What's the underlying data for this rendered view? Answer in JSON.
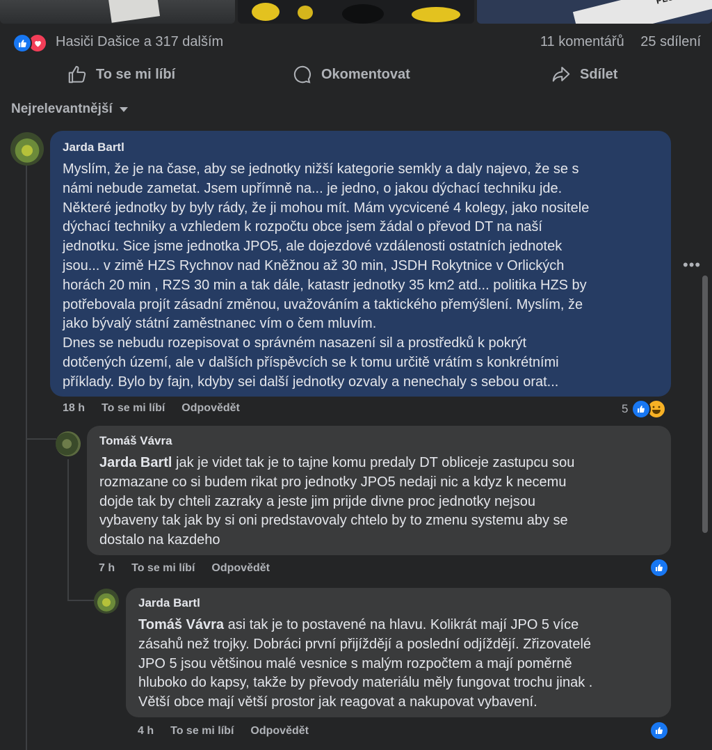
{
  "post": {
    "reactions": {
      "reactors_text": "Hasiči Dašice a 317 dalším",
      "comments_count": "11 komentářů",
      "shares_count": "25 sdílení"
    },
    "actions": {
      "like_label": "To se mi líbí",
      "comment_label": "Okomentovat",
      "share_label": "Sdílet"
    },
    "sort_label": "Nejrelevantnější"
  },
  "comments": [
    {
      "author": "Jarda Bartl",
      "text": "Myslím, že je na čase, aby se jednotky nižší kategorie semkly a daly najevo, že se s\nnámi nebude zametat. Jsem upřímně na... je jedno, o jakou dýchací techniku jde.\nNěkteré jednotky by byly rády, že ji mohou mít. Mám vycvicené 4 kolegy, jako nositele\ndýchací techniky a vzhledem k rozpočtu obce jsem žádal o převod DT na naší\njednotku. Sice jsme jednotka JPO5, ale dojezdové vzdálenosti ostatních jednotek\njsou... v zimě HZS Rychnov nad Kněžnou až 30 min, JSDH Rokytnice v Orlických\nhorách 20 min , RZS 30 min a tak dále, katastr jednotky 35 km2 atd... politika HZS by\npotřebovala projít zásadní změnou, uvažováním a taktického přemýšlení. Myslím, že\njako bývalý státní zaměstnanec vím o čem mluvím.\nDnes se nebudu rozepisovat o správném nasazení sil a prostředků k pokrýt\ndotčených území, ale v dalších příspěvcích se k tomu určitě vrátím s konkrétními\npříklady. Bylo by fajn, kdyby sei další jednotky ozvaly a nenechaly s sebou orat...",
      "time": "18 h",
      "like_label": "To se mi líbí",
      "reply_label": "Odpovědět",
      "reaction_count": "5"
    },
    {
      "author": "Tomáš Vávra",
      "mention": "Jarda Bartl",
      "text": " jak je videt tak je to tajne komu predaly DT obliceje zastupcu sou\nrozmazane co si budem rikat pro jednotky JPO5 nedaji nic a kdyz k necemu\ndojde tak by chteli zazraky a jeste jim prijde divne proc jednotky nejsou\nvybaveny tak jak by si oni predstavovaly chtelo by to zmenu systemu aby se\ndostalo na kazdeho",
      "time": "7 h",
      "like_label": "To se mi líbí",
      "reply_label": "Odpovědět"
    },
    {
      "author": "Jarda Bartl",
      "mention": "Tomáš Vávra",
      "text": " asi tak je to postavené na hlavu. Kolikrát mají JPO 5 více\nzásahů než trojky. Dobráci první přijíždějí a poslední odjíždějí. Zřizovatelé\nJPO 5 jsou většinou malé vesnice s malým rozpočtem a mají poměrně\nhluboko do kapsy, takže by převody materiálu měly fungovat trochu jinak .\nVětší obce mají větší prostor jak reagovat a nakupovat vybavení.",
      "time": "4 h",
      "like_label": "To se mi líbí",
      "reply_label": "Odpovědět"
    }
  ],
  "icons": {
    "like": "thumbs-up-icon",
    "love": "heart-icon",
    "comment": "speech-bubble-icon",
    "share": "share-arrow-icon",
    "haha": "laughing-face-icon",
    "more": "ellipsis-icon"
  },
  "colors": {
    "background": "#242526",
    "highlight_bubble": "#263c63",
    "reply_bubble": "#3a3b3c",
    "like_blue": "#1877f2",
    "love_red": "#f33e58"
  }
}
